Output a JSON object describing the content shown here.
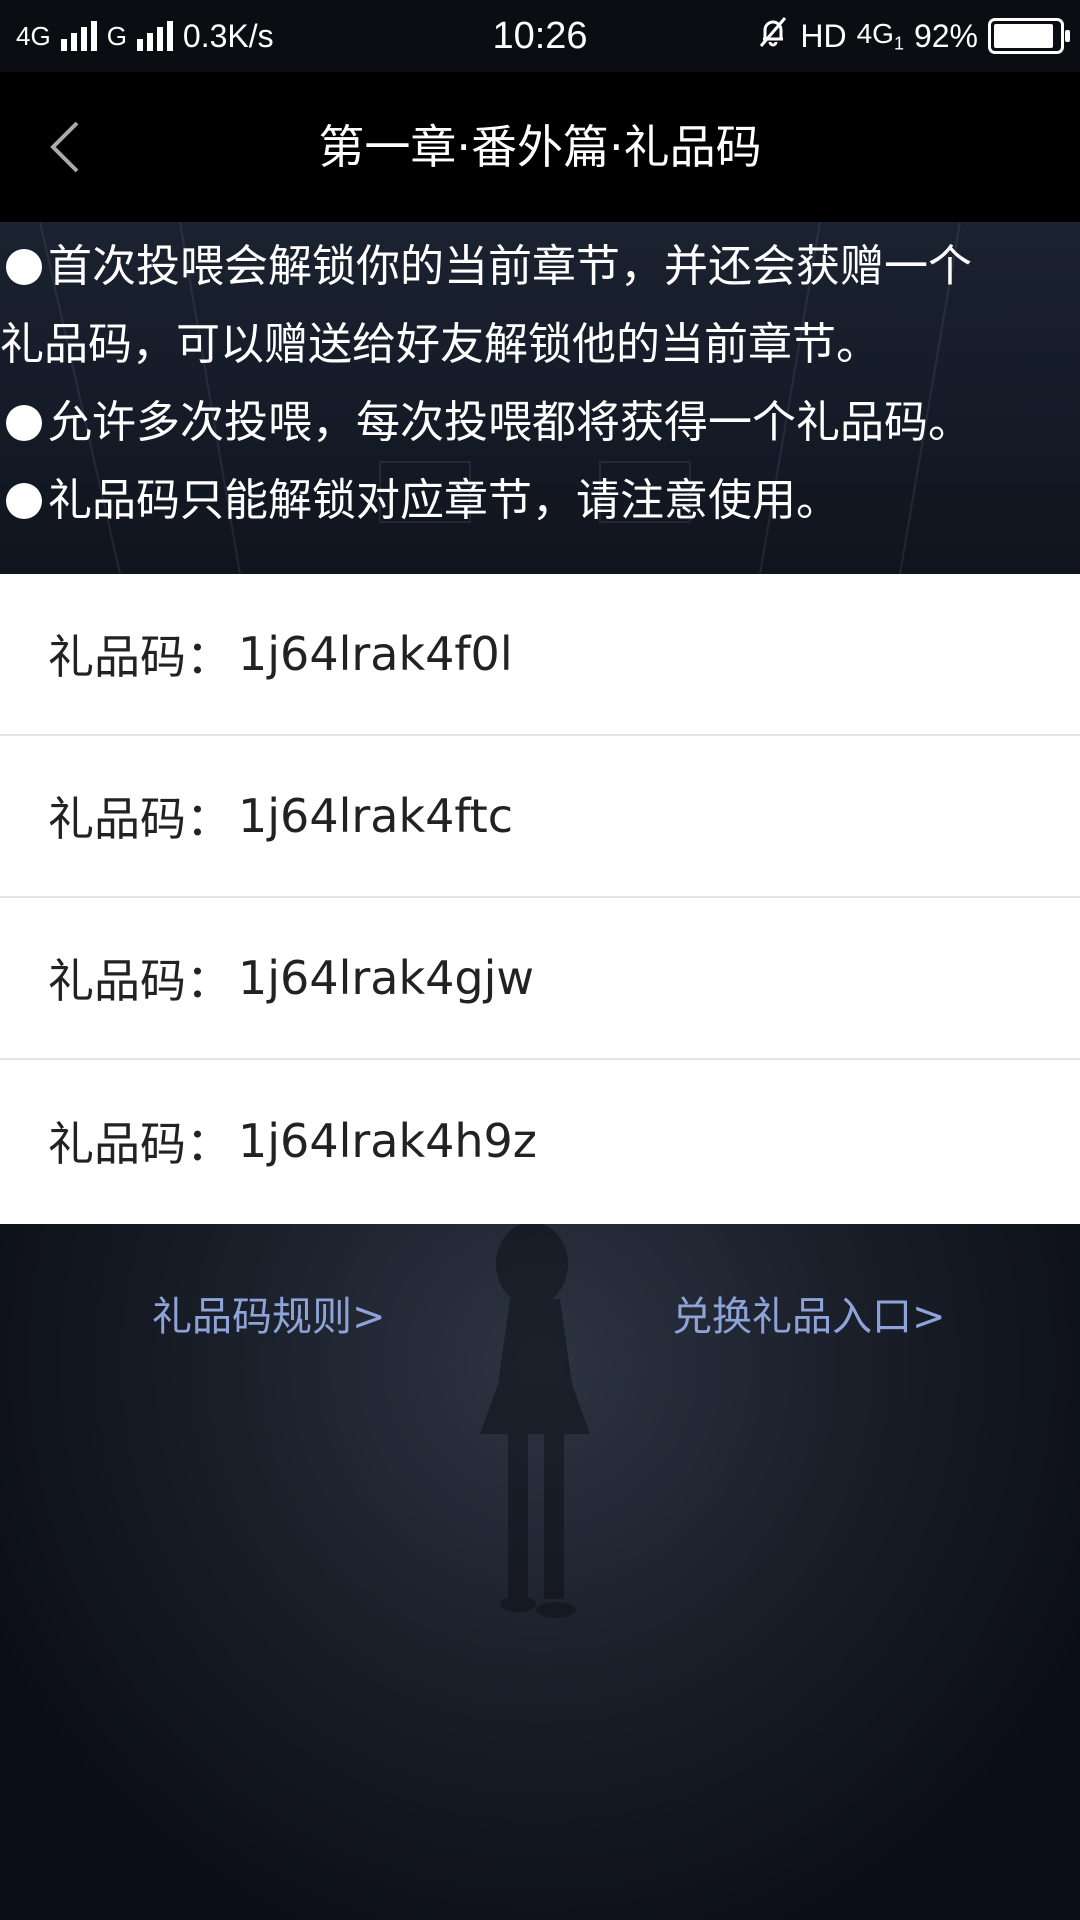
{
  "status_bar": {
    "network1": "4G",
    "network2": "G",
    "speed": "0.3K/s",
    "time": "10:26",
    "hd": "HD",
    "network3": "4G",
    "network3_sub": "1",
    "battery": "92%",
    "battery_level": 0.92
  },
  "header": {
    "title": "第一章·番外篇·礼品码"
  },
  "notice": {
    "line1": "首次投喂会解锁你的当前章节，并还会获赠一个",
    "line2": "礼品码，可以赠送给好友解锁他的当前章节。",
    "line3": "允许多次投喂，每次投喂都将获得一个礼品码。",
    "line4": "礼品码只能解锁对应章节，请注意使用。"
  },
  "gift_codes": [
    {
      "label": "礼品码：",
      "code": "1j64lrak4f0l"
    },
    {
      "label": "礼品码：",
      "code": "1j64lrak4ftc"
    },
    {
      "label": "礼品码：",
      "code": "1j64lrak4gjw"
    },
    {
      "label": "礼品码：",
      "code": "1j64lrak4h9z"
    }
  ],
  "links": {
    "rules": "礼品码规则>",
    "redeem": "兑换礼品入口>"
  },
  "icons": {
    "back": "chevron-left-icon",
    "mute": "bell-off-icon"
  }
}
